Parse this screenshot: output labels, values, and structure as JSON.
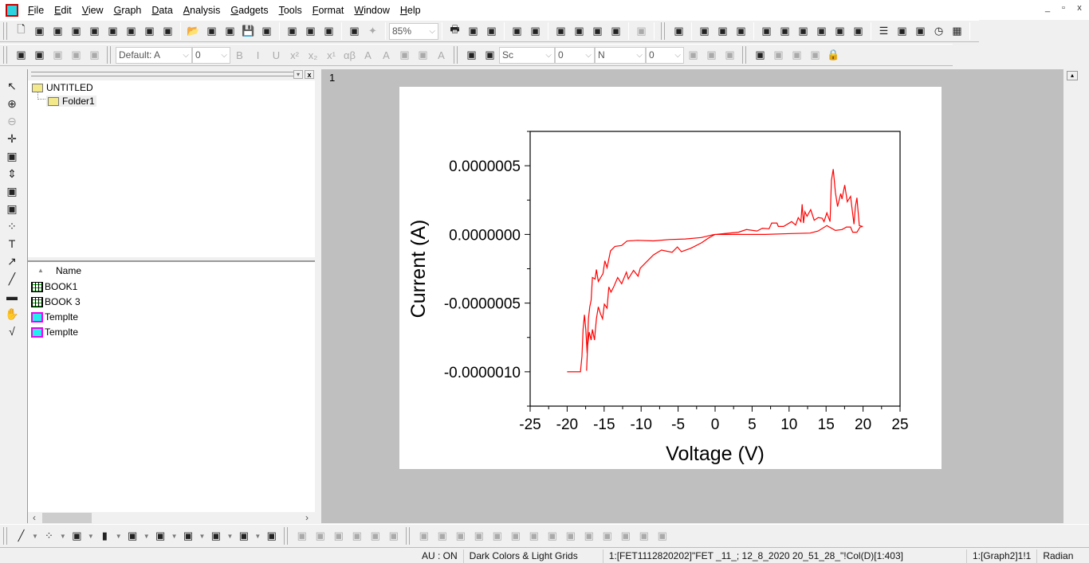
{
  "menu": [
    "File",
    "Edit",
    "View",
    "Graph",
    "Data",
    "Analysis",
    "Gadgets",
    "Tools",
    "Format",
    "Window",
    "Help"
  ],
  "window_controls": {
    "minimize": "_",
    "restore": "▫",
    "close": "x"
  },
  "toolbar1": {
    "groups": [
      [
        "new-project-icon",
        "new-folder-icon",
        "new-worksheet-icon",
        "new-excel-icon",
        "new-graph-icon",
        "new-matrix-icon",
        "new-function-icon",
        "new-layout-icon",
        "new-notes-icon"
      ],
      [
        "open-icon",
        "open-template-icon",
        "open-excel-icon",
        "save-project-icon",
        "save-template-icon"
      ],
      [
        "import-wizard-icon",
        "import-ascii-icon",
        "import-multiple-ascii-icon"
      ],
      [
        "recalculate-icon",
        "run-icon"
      ]
    ],
    "zoom_value": "85%",
    "groups2": [
      [
        "print-icon",
        "slideshow-icon",
        "copy-page-icon"
      ],
      [
        "code-builder-icon",
        "duplicate-icon"
      ],
      [
        "project-explorer-icon",
        "results-log-icon",
        "command-window-icon",
        "plugin-icon"
      ],
      [
        "add-column-icon"
      ]
    ],
    "groups3": [
      [
        "rescale-icon"
      ],
      [
        "layer-1-icon",
        "layer-2x2-icon",
        "layer-2x2b-icon"
      ],
      [
        "axis-bottom-left-icon",
        "axis-top-icon",
        "axis-right-icon",
        "axis-box-icon",
        "axis-small-icon",
        "axis-color-icon"
      ],
      [
        "legend-icon",
        "new-legend-icon",
        "color-scale-icon",
        "timestamp-icon",
        "table-icon"
      ]
    ]
  },
  "toolbar2": {
    "groups": [
      [
        "pen-icon",
        "open-object-icon",
        "object-group-icon",
        "push-icon",
        "clear-icon"
      ]
    ],
    "font": "Default: A",
    "font_size": "0",
    "format_icons": [
      "bold-icon",
      "italic-icon",
      "underline-icon",
      "superscript-icon",
      "subscript-icon",
      "supsub-icon",
      "greek-icon",
      "increase-font-icon",
      "decrease-font-icon",
      "align-icon",
      "column-align-icon",
      "font-color-icon"
    ],
    "line_style": "Sc",
    "line_width": "0",
    "fill": "N",
    "fill_value": "0",
    "tail_icons": [
      "pattern-icon",
      "grid-icon",
      "table-format-icon",
      "mask-icon",
      "unmask-icon",
      "expand-icon",
      "collapse-icon",
      "lock-icon"
    ]
  },
  "left_tools": [
    "pointer-icon",
    "zoom-in-icon",
    "zoom-out-icon",
    "screen-reader-icon",
    "data-selector-icon",
    "data-reader-icon",
    "region-select-icon",
    "mask-tool-icon",
    "draw-data-icon",
    "text-tool-icon",
    "arrow-tool-icon",
    "line-tool-icon",
    "rectangle-tool-icon",
    "pan-icon",
    "equation-icon"
  ],
  "explorer": {
    "root": "UNTITLED",
    "folder": "Folder1",
    "column_name": "Name",
    "items": [
      {
        "label": "BOOK1",
        "type": "book"
      },
      {
        "label": "BOOK 3",
        "type": "book"
      },
      {
        "label": "Templte",
        "type": "template"
      },
      {
        "label": "Templte",
        "type": "template"
      }
    ]
  },
  "graph_window": {
    "title": "1"
  },
  "chart_data": {
    "type": "line",
    "xlabel": "Voltage (V)",
    "ylabel": "Current (A)",
    "xlim": [
      -25,
      25
    ],
    "ylim": [
      -1.25e-06,
      7.5e-07
    ],
    "xticks": [
      -25,
      -20,
      -15,
      -10,
      -5,
      0,
      5,
      10,
      15,
      20,
      25
    ],
    "xtick_labels": [
      "-25",
      "-20",
      "-15",
      "-10",
      "-5",
      "0",
      "5",
      "10",
      "15",
      "20",
      "25"
    ],
    "yticks": [
      5e-07,
      0,
      -5e-07,
      -1e-06
    ],
    "ytick_labels": [
      "0.0000005",
      "0.0000000",
      "-0.0000005",
      "-0.0000010"
    ],
    "grid": false,
    "color": "#ff0000",
    "series": [
      {
        "points": [
          [
            -17.37,
            -9.92e-07
          ],
          [
            -17.23,
            -8.08e-07
          ],
          [
            -17.01,
            -7.11e-07
          ],
          [
            -16.76,
            -7.69e-07
          ],
          [
            -16.58,
            -6.92e-07
          ],
          [
            -16.3,
            -7.69e-07
          ],
          [
            -16.04,
            -6.14e-07
          ],
          [
            -15.79,
            -5.27e-07
          ],
          [
            -15.51,
            -5.76e-07
          ],
          [
            -15.22,
            -6.14e-07
          ],
          [
            -14.97,
            -5.08e-07
          ],
          [
            -14.6,
            -5.37e-07
          ],
          [
            -14.36,
            -3.82e-07
          ],
          [
            -14.07,
            -4.2e-07
          ],
          [
            -13.71,
            -3.82e-07
          ],
          [
            -13.17,
            -3.14e-07
          ],
          [
            -12.63,
            -3.59e-07
          ],
          [
            -11.99,
            -2.75e-07
          ],
          [
            -11.74,
            -3.24e-07
          ],
          [
            -11.02,
            -2.62e-07
          ],
          [
            -10.41,
            -3.04e-07
          ],
          [
            -10.12,
            -2.46e-07
          ],
          [
            -9.05,
            -1.88e-07
          ],
          [
            -8.33,
            -1.49e-07
          ],
          [
            -7.25,
            -1.14e-07
          ],
          [
            -5.81,
            -1.3e-07
          ],
          [
            -5.1,
            -9.1e-08
          ],
          [
            -4.56,
            -1.26e-07
          ],
          [
            -3.3,
            -1.01e-07
          ],
          [
            -1.87,
            -6.2e-08
          ],
          [
            -0.79,
            -2.3e-08
          ],
          [
            0,
            0
          ],
          [
            3.16,
            1.6e-08
          ],
          [
            4.24,
            3.5e-08
          ],
          [
            5.67,
            2.5e-08
          ],
          [
            6.39,
            4.5e-08
          ],
          [
            7.29,
            4.1e-08
          ],
          [
            7.65,
            8.3e-08
          ],
          [
            8.36,
            8.3e-08
          ],
          [
            8.54,
            5.8e-08
          ],
          [
            9.26,
            5.8e-08
          ],
          [
            10.34,
            9.3e-08
          ],
          [
            10.88,
            6.8e-08
          ],
          [
            11.24,
            1.22e-07
          ],
          [
            11.59,
            9.3e-08
          ],
          [
            11.77,
            2.19e-07
          ],
          [
            11.95,
            8.3e-08
          ],
          [
            12.13,
            1.65e-07
          ],
          [
            12.42,
            1.32e-07
          ],
          [
            12.92,
            1.8e-07
          ],
          [
            13.39,
            1.03e-07
          ],
          [
            13.93,
            1.22e-07
          ],
          [
            14.47,
            1.18e-07
          ],
          [
            14.72,
            9.3e-08
          ],
          [
            15.11,
            1.57e-07
          ],
          [
            15.54,
            9.3e-08
          ],
          [
            15.72,
            3.93e-07
          ],
          [
            15.97,
            4.75e-07
          ],
          [
            16.26,
            3.06e-07
          ],
          [
            16.55,
            2.03e-07
          ],
          [
            16.98,
            2.97e-07
          ],
          [
            17.16,
            2.58e-07
          ],
          [
            17.52,
            3.59e-07
          ],
          [
            17.87,
            2.38e-07
          ],
          [
            18.31,
            2.77e-07
          ],
          [
            18.77,
            7.4e-08
          ],
          [
            18.95,
            2e-07
          ],
          [
            19.17,
            2.67e-07
          ],
          [
            19.49,
            6.4e-08
          ],
          [
            19.96,
            5.8e-08
          ],
          [
            19.6,
            5.4e-08
          ],
          [
            19.17,
            1.6e-08
          ],
          [
            18.6,
            1.6e-08
          ],
          [
            18.31,
            5.4e-08
          ],
          [
            17.76,
            5.4e-08
          ],
          [
            17.16,
            3.5e-08
          ],
          [
            16.26,
            2.9e-08
          ],
          [
            15.11,
            6.4e-08
          ],
          [
            13.93,
            2.5e-08
          ],
          [
            12.85,
            1e-08
          ],
          [
            10.34,
            6e-09
          ],
          [
            6.75,
            0
          ],
          [
            0,
            0
          ],
          [
            -0.43,
            -4e-09
          ],
          [
            -1.87,
            -2.3e-08
          ],
          [
            -4.02,
            -3.3e-08
          ],
          [
            -6.17,
            -3.7e-08
          ],
          [
            -8.33,
            -4.7e-08
          ],
          [
            -10.48,
            -4.3e-08
          ],
          [
            -11.92,
            -4.8e-08
          ],
          [
            -12.63,
            -8.1e-08
          ],
          [
            -13.53,
            -8.7e-08
          ],
          [
            -14.14,
            -1.2e-07
          ],
          [
            -14.6,
            -2.42e-07
          ],
          [
            -14.9,
            -1.92e-07
          ],
          [
            -15.15,
            -2.85e-07
          ],
          [
            -15.79,
            -3.43e-07
          ],
          [
            -16.04,
            -2.56e-07
          ],
          [
            -16.22,
            -3.24e-07
          ],
          [
            -16.58,
            -3.14e-07
          ],
          [
            -16.76,
            -4.79e-07
          ],
          [
            -16.94,
            -5.27e-07
          ],
          [
            -17.12,
            -6.14e-07
          ],
          [
            -17.3,
            -8.66e-07
          ],
          [
            -17.48,
            -6.92e-07
          ],
          [
            -17.66,
            -5.85e-07
          ],
          [
            -17.84,
            -6.92e-07
          ],
          [
            -18.0,
            -8.86e-07
          ],
          [
            -18.2,
            -1e-06
          ],
          [
            -20.0,
            -1e-06
          ]
        ]
      }
    ]
  },
  "bottom_toolbar": [
    "line-plot-icon",
    "scatter-plot-icon",
    "line-symbol-plot-icon",
    "column-plot-icon",
    "plot-template-icon",
    "box-chart-icon",
    "area-plot-icon",
    "polar-plot-icon",
    "stock-plot-icon",
    "template-library-icon",
    "3d-plot-icon",
    "3d-bars-icon",
    "3d-surface-icon",
    "3d-wire-icon",
    "contour-icon",
    "image-icon",
    "align-left-icon",
    "align-right-icon",
    "align-top-icon",
    "align-bottom-icon",
    "align-center-h-icon",
    "align-center-v-icon",
    "align-middle-icon",
    "align-middle2-icon",
    "bring-front-icon",
    "send-back-icon",
    "group-icon",
    "ungroup-icon",
    "same-width-icon",
    "same-height-icon"
  ],
  "status": {
    "au": "AU : ON",
    "theme": "Dark Colors & Light Grids",
    "dataset": "1:[FET1112820202]\"FET _11_; 12_8_2020 20_51_28_\"!Col(D)[1:403]",
    "layer": "1:[Graph2]1!1",
    "angle": "Radian"
  }
}
